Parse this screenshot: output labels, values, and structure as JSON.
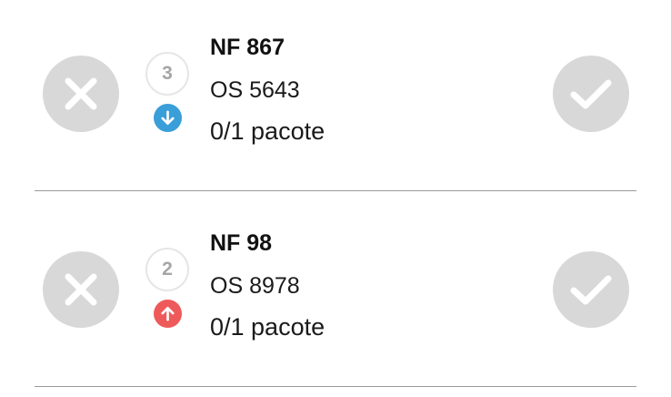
{
  "colors": {
    "action_button_bg": "#d8d8d8",
    "action_icon": "#ffffff",
    "sequence_text": "#a6a6a6",
    "direction_down": "#3a9fd8",
    "direction_up": "#ee5a5a",
    "divider": "#9a9a9a"
  },
  "deliveries": [
    {
      "nf": "NF 867",
      "os": "OS 5643",
      "packages": "0/1 pacote",
      "sequence": "3",
      "direction": "down",
      "direction_icon": "arrow-down-icon",
      "reject_icon": "close-icon",
      "confirm_icon": "check-icon"
    },
    {
      "nf": "NF 98",
      "os": "OS 8978",
      "packages": "0/1 pacote",
      "sequence": "2",
      "direction": "up",
      "direction_icon": "arrow-up-icon",
      "reject_icon": "close-icon",
      "confirm_icon": "check-icon"
    }
  ]
}
